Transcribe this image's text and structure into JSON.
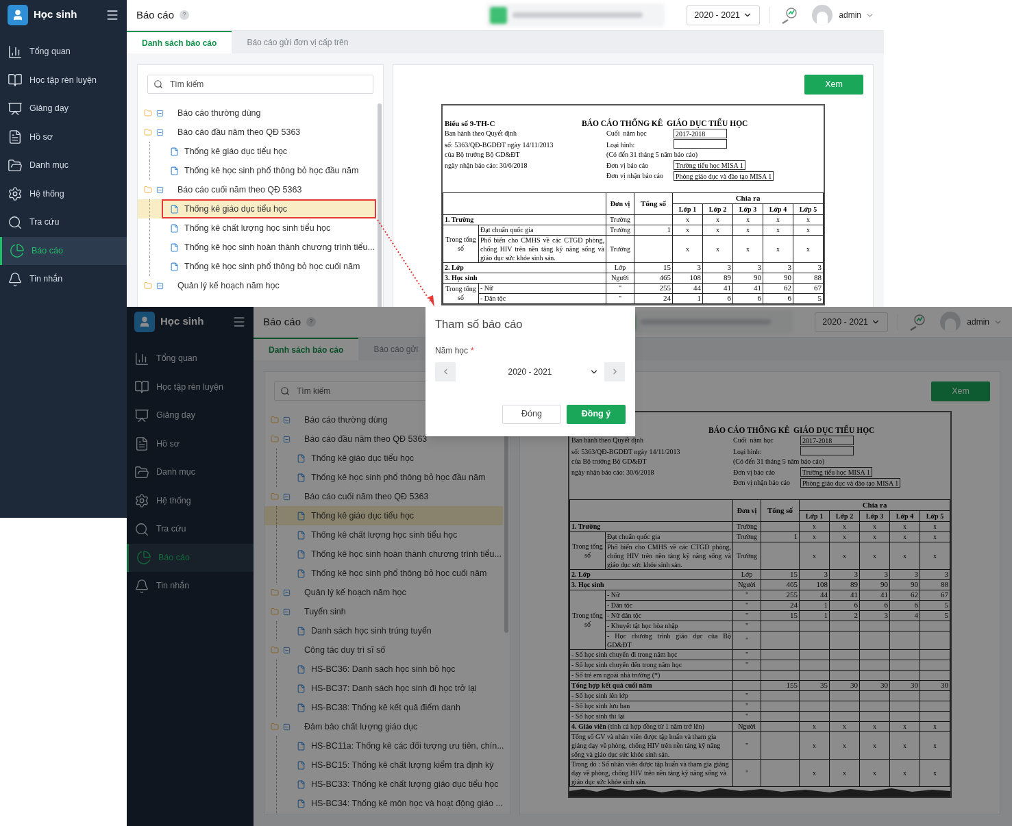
{
  "top_screen": {
    "sidebar": {
      "brand": "Học sinh",
      "items": [
        {
          "label": "Tổng quan",
          "selected": false
        },
        {
          "label": "Học tập rèn luyện",
          "selected": false
        },
        {
          "label": "Giảng dạy",
          "selected": false
        },
        {
          "label": "Hồ sơ",
          "selected": false
        },
        {
          "label": "Danh mục",
          "selected": false
        },
        {
          "label": "Hệ thống",
          "selected": false
        },
        {
          "label": "Tra cứu",
          "selected": false
        },
        {
          "label": "Báo cáo",
          "selected": true
        },
        {
          "label": "Tin nhắn",
          "selected": false
        }
      ]
    },
    "header": {
      "title": "Báo cáo",
      "help": "?",
      "school_year": "2020 - 2021",
      "user": "admin"
    },
    "tabs": [
      {
        "label": "Danh sách báo cáo",
        "selected": true
      },
      {
        "label": "Báo cáo gửi đơn vị cấp trên",
        "selected": false
      }
    ],
    "search": {
      "placeholder": "Tìm kiếm"
    },
    "tree": [
      {
        "label": "Báo cáo thường dùng",
        "expanded": true
      },
      {
        "label": "Báo cáo đầu năm theo QĐ 5363",
        "expanded": true,
        "children": [
          {
            "label": "Thống kê giáo dục tiểu học",
            "selected": false,
            "outlined": false
          },
          {
            "label": "Thống kê học sinh phổ thông bỏ học đầu năm",
            "selected": false,
            "outlined": false
          }
        ]
      },
      {
        "label": "Báo cáo cuối năm theo QĐ 5363",
        "expanded": true,
        "children": [
          {
            "label": "Thống kê giáo dục tiểu học",
            "selected": true,
            "outlined": true
          },
          {
            "label": "Thống kê chất lượng học sinh tiểu học",
            "selected": false,
            "outlined": false
          },
          {
            "label": "Thống kê học sinh hoàn thành chương trình tiểu...",
            "selected": false,
            "outlined": false
          },
          {
            "label": "Thống kê học sinh phổ thông bỏ học cuối năm",
            "selected": false,
            "outlined": false
          }
        ]
      },
      {
        "label": "Quản lý kế hoạch năm học",
        "expanded": true
      }
    ],
    "view_button": "Xem",
    "report": {
      "form_code": "Biểu số 9-TH-C",
      "title": "BÁO CÁO THỐNG KÊ  GIÁO DỤC TIỂU HỌC",
      "info": [
        {
          "kind": "field",
          "left": "Ban hành theo Quyết định",
          "middle": "Cuối  năm học",
          "value": "2017-2018"
        },
        {
          "kind": "field",
          "left": "số: 5363/QĐ-BGDĐT ngày 14/11/2013",
          "middle": "Loại hình:"
        },
        {
          "kind": "note",
          "left": "của Bộ trưởng Bộ GD&ĐT",
          "middle": "(Có đến 31 tháng 5 năm báo cáo)"
        },
        {
          "kind": "field",
          "left": "ngày nhận báo cáo: 30/6/2018",
          "middle": "Đơn vị báo cáo",
          "value": "Trường tiểu học MISA 1"
        },
        {
          "kind": "field",
          "middle": "Đơn vị nhận báo cáo",
          "value": "Phòng giáo dục và đào tạo MISA 1"
        }
      ],
      "columns": {
        "unit": "Đơn vị",
        "total": "Tổng số",
        "split": "Chia ra",
        "grades": [
          "Lớp 1",
          "Lớp 2",
          "Lớp 3",
          "Lớp 4",
          "Lớp 5"
        ]
      },
      "rows": [
        {
          "kind": "row",
          "label": "1. Trường",
          "bold": true,
          "unit": "Trường",
          "values": [
            "x",
            "x",
            "x",
            "x",
            "x"
          ]
        },
        {
          "kind": "group",
          "label": "Trong tổng số",
          "rows": [
            {
              "label": "Đạt chuẩn quốc gia",
              "unit": "Trường",
              "total": "1",
              "values": [
                "x",
                "x",
                "x",
                "x",
                "x"
              ]
            },
            {
              "label": "Phổ biến cho CMHS về các CTGD phòng, chống HIV trên nền tảng kỹ năng sống và giáo dục sức khỏe sinh sản.",
              "unit": "Trường",
              "values": [
                "x",
                "x",
                "x",
                "x",
                "x"
              ]
            }
          ]
        },
        {
          "kind": "row",
          "label": "2. Lớp",
          "bold": true,
          "unit": "Lớp",
          "total": "15",
          "values": [
            "3",
            "3",
            "3",
            "3",
            "3"
          ]
        },
        {
          "kind": "row",
          "label": "3. Học sinh",
          "bold": true,
          "unit": "Người",
          "total": "465",
          "values": [
            "108",
            "89",
            "90",
            "90",
            "88"
          ]
        },
        {
          "kind": "group",
          "label": "Trong tổng số",
          "rows": [
            {
              "label": "- Nữ",
              "unit": "\"",
              "total": "255",
              "values": [
                "44",
                "41",
                "41",
                "62",
                "67"
              ]
            },
            {
              "label": "- Dân tộc",
              "unit": "\"",
              "total": "24",
              "values": [
                "1",
                "6",
                "6",
                "6",
                "5"
              ]
            }
          ]
        }
      ]
    }
  },
  "bottom_screen": {
    "sidebar": {
      "brand": "Học sinh",
      "items": [
        {
          "label": "Tổng quan",
          "selected": false
        },
        {
          "label": "Học tập rèn luyện",
          "selected": false
        },
        {
          "label": "Giảng dạy",
          "selected": false
        },
        {
          "label": "Hồ sơ",
          "selected": false
        },
        {
          "label": "Danh mục",
          "selected": false
        },
        {
          "label": "Hệ thống",
          "selected": false
        },
        {
          "label": "Tra cứu",
          "selected": false
        },
        {
          "label": "Báo cáo",
          "selected": true
        },
        {
          "label": "Tin nhắn",
          "selected": false
        }
      ]
    },
    "header": {
      "title": "Báo cáo",
      "help": "?",
      "school_year": "2020 - 2021",
      "user": "admin"
    },
    "tabs": [
      {
        "label": "Danh sách báo cáo",
        "selected": true
      },
      {
        "label": "Báo cáo gửi",
        "selected": false
      }
    ],
    "search": {
      "placeholder": "Tìm kiếm"
    },
    "tree": [
      {
        "label": "Báo cáo thường dùng",
        "expanded": true
      },
      {
        "label": "Báo cáo đầu năm theo QĐ 5363",
        "expanded": true,
        "children": [
          {
            "label": "Thống kê giáo dục tiểu học",
            "selected": false
          },
          {
            "label": "Thống kê học sinh phổ thông bỏ học đầu năm",
            "selected": false
          }
        ]
      },
      {
        "label": "Báo cáo cuối năm theo QĐ 5363",
        "expanded": true,
        "children": [
          {
            "label": "Thống kê giáo dục tiểu học",
            "selected": true
          },
          {
            "label": "Thống kê chất lượng học sinh tiểu học",
            "selected": false
          },
          {
            "label": "Thống kê học sinh hoàn thành chương trình tiểu...",
            "selected": false
          },
          {
            "label": "Thống kê học sinh phổ thông bỏ học cuối năm",
            "selected": false
          }
        ]
      },
      {
        "label": "Quản lý kế hoạch năm học",
        "expanded": true
      },
      {
        "label": "Tuyển sinh",
        "expanded": true,
        "children": [
          {
            "label": "Danh sách học sinh trúng tuyển",
            "selected": false
          }
        ]
      },
      {
        "label": "Công tác duy trì sĩ số",
        "expanded": true,
        "children": [
          {
            "label": "HS-BC36: Danh sách học sinh bỏ học",
            "selected": false
          },
          {
            "label": "HS-BC37: Danh sách học sinh đi học trở lại",
            "selected": false
          },
          {
            "label": "HS-BC38: Thống kê kết quả điểm danh",
            "selected": false
          }
        ]
      },
      {
        "label": "Đảm bảo chất lượng giáo dục",
        "expanded": true,
        "children": [
          {
            "label": "HS-BC11a: Thống kê các đối tượng ưu tiên, chín...",
            "selected": false
          },
          {
            "label": "HS-BC15: Thống kê chất lượng kiểm tra định kỳ",
            "selected": false
          },
          {
            "label": "HS-BC33: Thống kê chất lượng giáo dục tiểu học",
            "selected": false
          },
          {
            "label": "HS-BC34: Thống kê môn học và hoạt động giáo ...",
            "selected": false
          }
        ]
      }
    ],
    "view_button": "Xem",
    "report": {
      "title": "BÁO CÁO THỐNG KÊ  GIÁO DỤC TIỂU HỌC",
      "torn_edge": true,
      "info": [
        {
          "kind": "field",
          "left": "Ban hành theo Quyết định",
          "middle": "Cuối  năm học",
          "value": "2017-2018"
        },
        {
          "kind": "field",
          "left": "số: 5363/QĐ-BGDĐT ngày 14/11/2013",
          "middle": "Loại hình:"
        },
        {
          "kind": "note",
          "left": "của Bộ trưởng Bộ GD&ĐT",
          "middle": "(Có đến 31 tháng 5 năm báo cáo)"
        },
        {
          "kind": "field",
          "left": "ngày nhận báo cáo: 30/6/2018",
          "middle": "Đơn vị báo cáo",
          "value": "Trường tiểu học MISA 1"
        },
        {
          "kind": "field",
          "middle": "Đơn vị nhận báo cáo",
          "value": "Phòng giáo dục và đào tạo MISA 1"
        }
      ],
      "columns": {
        "unit": "Đơn vị",
        "total": "Tổng số",
        "split": "Chia ra",
        "grades": [
          "Lớp 1",
          "Lớp 2",
          "Lớp 3",
          "Lớp 4",
          "Lớp 5"
        ]
      },
      "rows": [
        {
          "kind": "row",
          "label": "1. Trường",
          "bold": true,
          "unit": "Trường",
          "values": [
            "x",
            "x",
            "x",
            "x",
            "x"
          ]
        },
        {
          "kind": "group",
          "label": "Trong tổng số",
          "rows": [
            {
              "label": "Đạt chuẩn quốc gia",
              "unit": "Trường",
              "total": "1",
              "values": [
                "x",
                "x",
                "x",
                "x",
                "x"
              ]
            },
            {
              "label": "Phổ biến cho CMHS về các CTGD phòng, chống HIV trên nền tảng kỹ năng sống và giáo dục sức khỏe sinh sản.",
              "unit": "Trường",
              "values": [
                "x",
                "x",
                "x",
                "x",
                "x"
              ]
            }
          ]
        },
        {
          "kind": "row",
          "label": "2. Lớp",
          "bold": true,
          "unit": "Lớp",
          "total": "15",
          "values": [
            "3",
            "3",
            "3",
            "3",
            "3"
          ]
        },
        {
          "kind": "row",
          "label": "3. Học sinh",
          "bold": true,
          "unit": "Người",
          "total": "465",
          "values": [
            "108",
            "89",
            "90",
            "90",
            "88"
          ]
        },
        {
          "kind": "group",
          "label": "Trong tổng số",
          "rows": [
            {
              "label": "- Nữ",
              "unit": "\"",
              "total": "255",
              "values": [
                "44",
                "41",
                "41",
                "62",
                "67"
              ]
            },
            {
              "label": "- Dân tộc",
              "unit": "\"",
              "total": "24",
              "values": [
                "1",
                "6",
                "6",
                "6",
                "5"
              ]
            },
            {
              "label": "- Nữ dân tộc",
              "unit": "\"",
              "total": "15",
              "values": [
                "1",
                "2",
                "3",
                "4",
                "5"
              ]
            },
            {
              "label": "- Khuyết tật học hòa nhập",
              "unit": "\""
            },
            {
              "label": "- Học chương trình giáo dục của Bộ GD&ĐT",
              "unit": "\""
            }
          ]
        },
        {
          "kind": "row",
          "label": "- Số học sinh chuyển đi trong năm học",
          "bold": false,
          "unit": "\""
        },
        {
          "kind": "row",
          "label": "- Số học sinh chuyển đến trong năm học",
          "bold": false,
          "unit": "\""
        },
        {
          "kind": "row",
          "label": "- Số trẻ em ngoài nhà trường (*)",
          "bold": false
        },
        {
          "kind": "row",
          "label": "Tổng hợp kết quả cuối năm",
          "bold": true,
          "total": "155",
          "values": [
            "35",
            "30",
            "30",
            "30",
            "30"
          ]
        },
        {
          "kind": "row",
          "label": "- Số học sinh lên lớp",
          "bold": false,
          "unit": "\""
        },
        {
          "kind": "row",
          "label": "- Số học sinh lưu ban",
          "bold": false,
          "unit": "\""
        },
        {
          "kind": "row",
          "label": "- Số học sinh thi lại",
          "bold": false,
          "unit": "\""
        },
        {
          "kind": "row",
          "label": "**4. Giáo viên** (tính cả hợp đồng từ 1 năm trở lên)",
          "bold": false,
          "unit": "Người",
          "values": [
            "x",
            "x",
            "x",
            "x",
            "x"
          ]
        },
        {
          "kind": "row",
          "label": "Tổng số GV và nhân viên được tập huấn và tham gia giảng dạy về phòng, chống HIV trên nền tảng kỹ năng sống và giáo dục sức khỏe sinh sản.",
          "bold": false,
          "unit": "\"",
          "values": [
            "x",
            "x",
            "x",
            "x",
            "x"
          ]
        },
        {
          "kind": "row",
          "label": "Trong đó : Số nhân viên được tập huấn và tham gia giảng dạy về phòng, chống HIV trên nền tảng kỹ năng sống và giáo dục sức khỏe sinh sản.",
          "bold": false,
          "unit": "\"",
          "values": [
            "x",
            "x",
            "x",
            "x",
            "x"
          ]
        }
      ]
    },
    "dialog": {
      "title": "Tham số báo cáo",
      "field_label": "Năm học",
      "required_mark": "*",
      "value": "2020 - 2021",
      "buttons": [
        "Đóng",
        "Đồng ý"
      ]
    }
  }
}
